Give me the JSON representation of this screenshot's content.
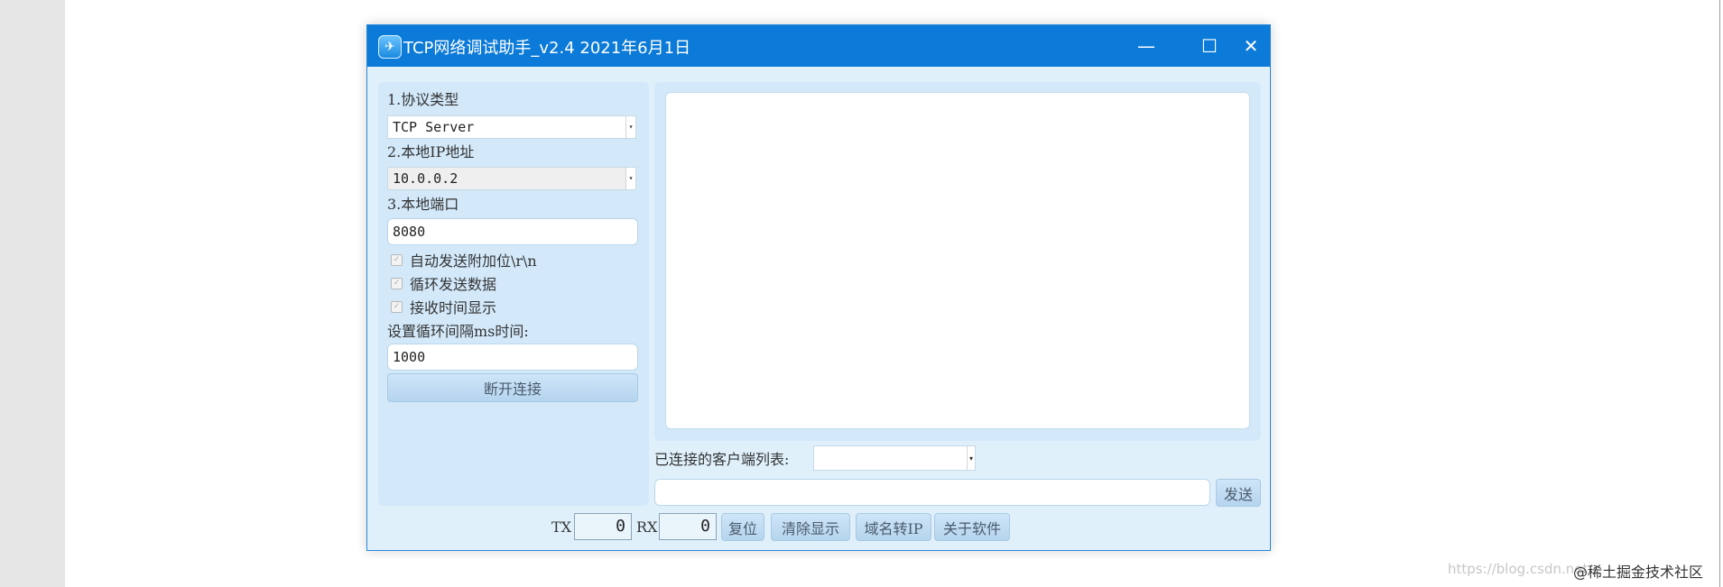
{
  "window": {
    "title": "TCP网络调试助手_v2.4 2021年6月1日",
    "controls": {
      "minimize": "—",
      "maximize": "☐",
      "close": "✕"
    }
  },
  "settings": {
    "protocol_label": "1.协议类型",
    "protocol_value": "TCP Server",
    "local_ip_label": "2.本地IP地址",
    "local_ip_value": "10.0.0.2",
    "local_port_label": "3.本地端口",
    "local_port_value": "8080",
    "checkboxes": [
      {
        "label": "自动发送附加位\\r\\n",
        "checked": true
      },
      {
        "label": "循环发送数据",
        "checked": true
      },
      {
        "label": "接收时间显示",
        "checked": true
      }
    ],
    "interval_label": "设置循环间隔ms时间:",
    "interval_value": "1000",
    "disconnect_label": "断开连接"
  },
  "clients": {
    "label": "已连接的客户端列表:",
    "selected": ""
  },
  "send": {
    "input_value": "",
    "button_label": "发送"
  },
  "status": {
    "tx_label": "TX",
    "tx_value": "0",
    "rx_label": "RX",
    "rx_value": "0",
    "buttons": [
      "复位",
      "清除显示",
      "域名转IP",
      "关于软件"
    ]
  },
  "watermark": {
    "url": "https://blog.csdn.net",
    "community": "@稀土掘金技术社区"
  },
  "colors": {
    "titlebar": "#0b7ad8",
    "window_bg": "#dff0fb",
    "panel_bg": "#d3e9fa"
  }
}
